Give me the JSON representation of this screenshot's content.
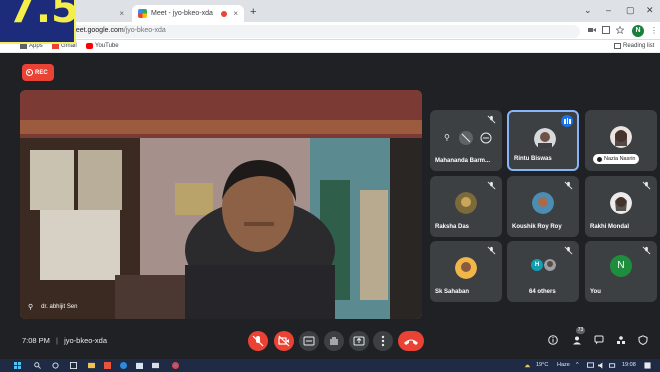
{
  "browser": {
    "tab_inactive_close": "×",
    "tab_active_title": "Meet - jyo-bkeo-xda",
    "tab_active_close": "×",
    "new_tab": "+",
    "url_host": "meet.google.com",
    "url_path": "/jyo-bkeo-xda",
    "profile_initial": "N",
    "win_min": "–",
    "win_max": "▢",
    "win_close": "✕",
    "win_down": "⌄"
  },
  "bookmarks": {
    "apps": "Apps",
    "gmail": "Gmail",
    "youtube": "YouTube",
    "reading_list": "Reading list"
  },
  "overlay": {
    "badge_text": "7.5"
  },
  "meet": {
    "rec_label": "REC",
    "main_speaker_name": "dr. abhijit Sen",
    "participants": [
      {
        "name": "Mahananda Barm..."
      },
      {
        "name": "Rintu Biswas"
      },
      {
        "name": "Nazia Nasrin"
      },
      {
        "name": "Raksha Das"
      },
      {
        "name": "Koushik Roy Roy"
      },
      {
        "name": "Rakhi Mondal"
      },
      {
        "name": "Sk Sahaban"
      },
      {
        "name": "64 others"
      },
      {
        "name": "You"
      }
    ],
    "others_initial": "H",
    "you_initial": "N",
    "meeting_time": "7:08 PM",
    "meeting_code": "jyo-bkeo-xda",
    "people_count": "73"
  },
  "taskbar": {
    "weather": "19°C",
    "weather_desc": "Haze",
    "clock": "19:08"
  },
  "colors": {
    "meet_bg": "#202124",
    "tile_bg": "#3c4043",
    "red": "#ea4335",
    "badge_bg": "#1c2b7a",
    "badge_fg": "#f4ee4a"
  }
}
